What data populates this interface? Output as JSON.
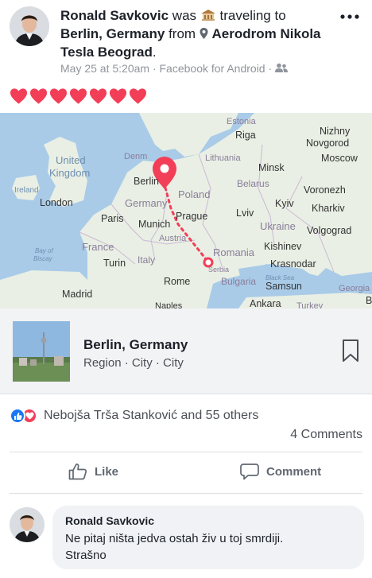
{
  "post": {
    "author": "Ronald Savkovic",
    "was": "was",
    "activity": "traveling to",
    "destination": "Berlin, Germany",
    "from": "from",
    "origin_line1": "Aerodrom Nikola",
    "origin_line2": "Tesla Beograd",
    "period": ".",
    "meta": "May 25 at 5:20am · Facebook for Android ·",
    "hearts_count": 7
  },
  "map_labels": {
    "estonia": "Estonia",
    "riga": "Riga",
    "nizhny1": "Nizhny",
    "nizhny2": "Novgorod",
    "moscow": "Moscow",
    "united": "United",
    "kingdom": "Kingdom",
    "denmark": "Denm",
    "lithuania": "Lithuania",
    "minsk": "Minsk",
    "ireland": "Ireland",
    "berlin": "Berlin",
    "belarus": "Belarus",
    "voronezh": "Voronezh",
    "london": "London",
    "germany": "Germany",
    "poland": "Poland",
    "kyiv": "Kyiv",
    "kharkiv": "Kharkiv",
    "paris": "Paris",
    "munich": "Munich",
    "prague": "Prague",
    "lviv": "Lviv",
    "ukraine": "Ukraine",
    "volgograd": "Volgograd",
    "austria": "Austria",
    "kishinev": "Kishinev",
    "bay1": "Bay of",
    "bay2": "Biscay",
    "france": "France",
    "romania": "Romania",
    "krasnodar": "Krasnodar",
    "turin": "Turin",
    "italy": "Italy",
    "serbia": "Serbia",
    "blacksea": "Black Sea",
    "rome": "Rome",
    "bulgaria": "Bulgaria",
    "samsun": "Samsun",
    "georgia": "Georgia",
    "madrid": "Madrid",
    "naples": "Naples",
    "ankara": "Ankara",
    "turkey": "Turkey",
    "edge_b": "B"
  },
  "place": {
    "name": "Berlin, Germany",
    "category": "Region · City · City"
  },
  "reactions": {
    "text": "Nebojša Trša Stanković and 55 others",
    "comments": "4 Comments"
  },
  "actions": {
    "like": "Like",
    "comment": "Comment"
  },
  "comment": {
    "author": "Ronald Savkovic",
    "line1": "Ne pitaj ništa jedva ostah živ u toj smrdiji.",
    "line2": "Strašno"
  },
  "colors": {
    "accent": "#1877f2",
    "heart": "#f33e58",
    "map_land": "#e9efe4",
    "map_water": "#a9cbe8",
    "route": "#f33e58"
  }
}
